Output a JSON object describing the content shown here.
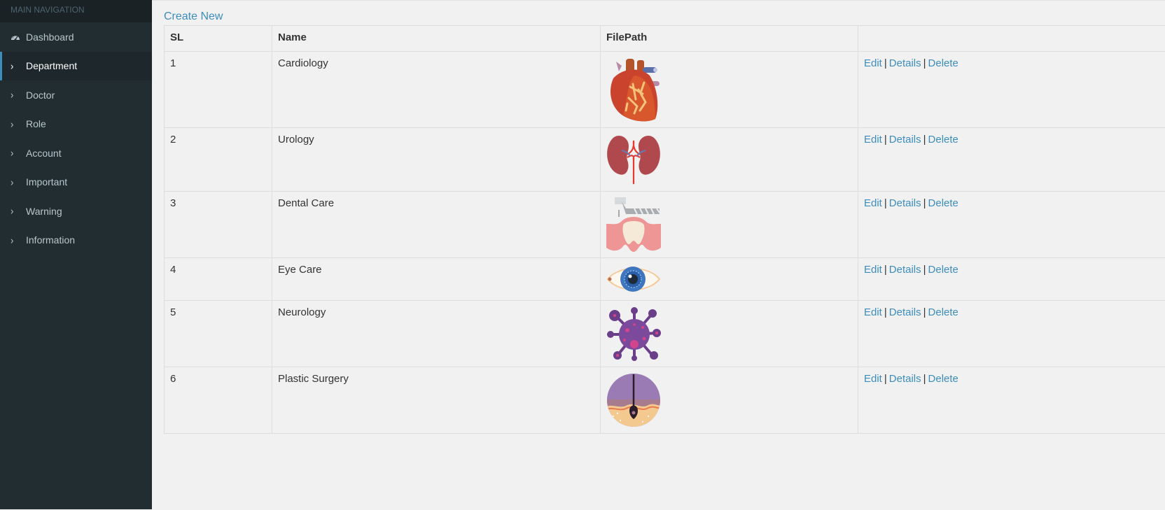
{
  "sidebar": {
    "header": "MAIN NAVIGATION",
    "items": [
      {
        "label": "Dashboard",
        "icon": "dashboard-icon"
      },
      {
        "label": "Department",
        "icon": "chevron-right-icon",
        "active": true
      },
      {
        "label": "Doctor",
        "icon": "chevron-right-icon"
      },
      {
        "label": "Role",
        "icon": "chevron-right-icon"
      },
      {
        "label": "Account",
        "icon": "chevron-right-icon"
      },
      {
        "label": "Important",
        "icon": "chevron-right-icon"
      },
      {
        "label": "Warning",
        "icon": "chevron-right-icon"
      },
      {
        "label": "Information",
        "icon": "chevron-right-icon"
      }
    ]
  },
  "main": {
    "create_new": "Create New",
    "table": {
      "headers": [
        "SL",
        "Name",
        "FilePath",
        ""
      ],
      "rows": [
        {
          "sl": "1",
          "name": "Cardiology",
          "image": "heart-image"
        },
        {
          "sl": "2",
          "name": "Urology",
          "image": "kidneys-image"
        },
        {
          "sl": "3",
          "name": "Dental Care",
          "image": "tooth-image"
        },
        {
          "sl": "4",
          "name": "Eye Care",
          "image": "eye-image"
        },
        {
          "sl": "5",
          "name": "Neurology",
          "image": "virus-image"
        },
        {
          "sl": "6",
          "name": "Plastic Surgery",
          "image": "hair-follicle-image"
        }
      ],
      "actions": {
        "edit": "Edit",
        "details": "Details",
        "delete": "Delete",
        "separator": "|"
      }
    }
  },
  "colors": {
    "sidebar_bg": "#222d32",
    "sidebar_header_bg": "#1a2226",
    "active_border": "#3c8dbc",
    "link": "#3c8dbc",
    "page_bg": "#f1f1f1"
  }
}
